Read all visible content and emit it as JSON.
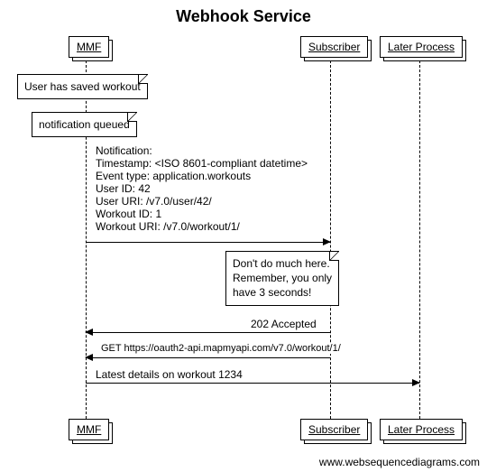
{
  "title": "Webhook Service",
  "actors": {
    "mmf": "MMF",
    "subscriber": "Subscriber",
    "later": "Later Process"
  },
  "notes": {
    "saved": "User has saved workout",
    "queued": "notification queued",
    "notification": "Notification:\nTimestamp: <ISO 8601-compliant datetime>\nEvent type: application.workouts\nUser ID: 42\nUser URI: /v7.0/user/42/\nWorkout ID: 1\nWorkout URI: /v7.0/workout/1/",
    "warn": "Don't do much here.\nRemember, you only\nhave 3 seconds!"
  },
  "messages": {
    "accepted": "202 Accepted",
    "get": "GET https://oauth2-api.mapmyapi.com/v7.0/workout/1/",
    "latest": "Latest details on workout 1234"
  },
  "attribution": "www.websequencediagrams.com",
  "chart_data": {
    "type": "sequence-diagram",
    "title": "Webhook Service",
    "participants": [
      "MMF",
      "Subscriber",
      "Later Process"
    ],
    "events": [
      {
        "kind": "note",
        "over": "MMF",
        "text": "User has saved workout"
      },
      {
        "kind": "note",
        "over": "MMF",
        "text": "notification queued"
      },
      {
        "kind": "message",
        "from": "MMF",
        "to": "Subscriber",
        "text": "Notification:\nTimestamp: <ISO 8601-compliant datetime>\nEvent type: application.workouts\nUser ID: 42\nUser URI: /v7.0/user/42/\nWorkout ID: 1\nWorkout URI: /v7.0/workout/1/"
      },
      {
        "kind": "note",
        "over": "Subscriber",
        "text": "Don't do much here.\nRemember, you only\nhave 3 seconds!"
      },
      {
        "kind": "message",
        "from": "Subscriber",
        "to": "MMF",
        "text": "202 Accepted"
      },
      {
        "kind": "message",
        "from": "Subscriber",
        "to": "MMF",
        "text": "GET https://oauth2-api.mapmyapi.com/v7.0/workout/1/"
      },
      {
        "kind": "message",
        "from": "MMF",
        "to": "Later Process",
        "text": "Latest details on workout 1234"
      }
    ]
  }
}
